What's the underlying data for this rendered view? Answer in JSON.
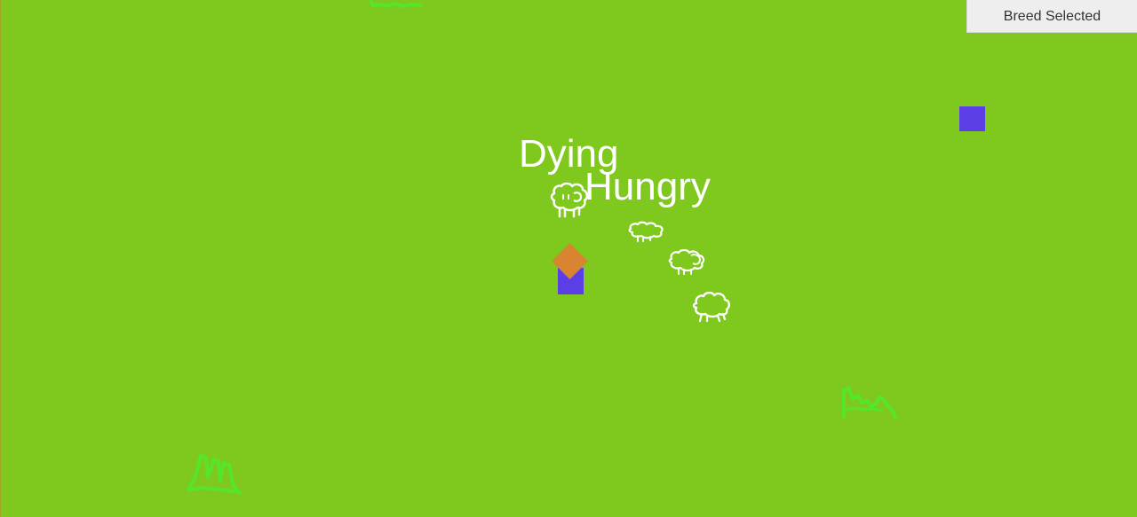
{
  "toolbar": {
    "breed_selected_label": "Breed Selected"
  },
  "sheep_status": {
    "dying": "Dying",
    "hungry": "Hungry"
  },
  "colors": {
    "grass": "#7fc91e",
    "grass_tuft": "#55e62b",
    "player_cube": "#5b3ee6",
    "player_marker": "#d98430",
    "label_text": "#ffffff",
    "button_bg": "#eeeeee"
  },
  "scene": {
    "sheep_count": 4,
    "grass_tuft_count": 3,
    "cube_count": 2
  }
}
